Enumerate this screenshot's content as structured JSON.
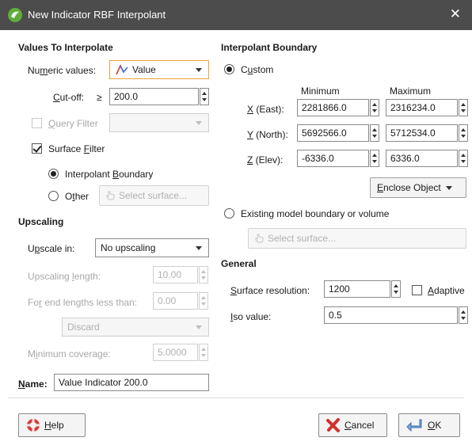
{
  "window": {
    "title": "New Indicator RBF Interpolant",
    "close_glyph": "✕"
  },
  "values_to_interpolate": {
    "header": "Values To Interpolate",
    "numeric_values": {
      "label_pre": "Nu",
      "label_ul": "m",
      "label_post": "eric values:",
      "value": "Value",
      "icon": "indicator-icon"
    },
    "cutoff": {
      "label_ul": "C",
      "label_post": "ut-off:",
      "symbol": "≥",
      "value": "200.0"
    },
    "query_filter": {
      "label_ul": "Q",
      "label_post": "uery Filter",
      "checked": false,
      "enabled": false,
      "value": ""
    },
    "surface_filter": {
      "label_pre": "Surface ",
      "label_ul": "F",
      "label_post": "ilter",
      "checked": true
    },
    "interpolant_boundary_option": {
      "label_pre": "Interpolant ",
      "label_ul": "B",
      "label_post": "oundary",
      "selected": true
    },
    "other_option": {
      "label_pre": "O",
      "label_ul": "t",
      "label_post": "her",
      "selected": false,
      "select_surface_label": "Select surface..."
    }
  },
  "upscaling": {
    "header": "Upscaling",
    "upscale_in": {
      "label_pre": "U",
      "label_ul": "p",
      "label_post": "scale in:",
      "value": "No upscaling"
    },
    "upscaling_length": {
      "label_pre": "Upscaling ",
      "label_ul": "l",
      "label_post": "ength:",
      "value": "10.00"
    },
    "end_lengths": {
      "label_pre": "Fo",
      "label_ul": "r",
      "label_post": " end lengths less than:",
      "value": "0.00"
    },
    "end_action": {
      "value": "Discard"
    },
    "minimum_coverage": {
      "label_pre": "M",
      "label_ul": "i",
      "label_post": "nimum coverage:",
      "value": "5.0000"
    }
  },
  "name": {
    "label_ul": "N",
    "label_post": "ame:",
    "value": "Value Indicator 200.0"
  },
  "interpolant_boundary": {
    "header": "Interpolant Boundary",
    "custom_option": {
      "label_pre": "C",
      "label_ul": "u",
      "label_post": "stom",
      "selected": true
    },
    "col_min": "Minimum",
    "col_max": "Maximum",
    "rows": [
      {
        "label_ul": "X",
        "label_post": " (East):",
        "min": "2281866.0",
        "max": "2316234.0"
      },
      {
        "label_ul": "Y",
        "label_post": " (North):",
        "min": "5692566.0",
        "max": "5712534.0"
      },
      {
        "label_ul": "Z",
        "label_post": " (Elev):",
        "min": "-6336.0",
        "max": "6336.0"
      }
    ],
    "enclose_object": {
      "label_ul": "E",
      "label_post": "nclose Object"
    },
    "existing_option": {
      "label": "Existing model boundary or volume",
      "selected": false
    },
    "select_surface_label": "Select surface..."
  },
  "general": {
    "header": "General",
    "surface_resolution": {
      "label_ul": "S",
      "label_post": "urface resolution:",
      "value": "1200"
    },
    "adaptive": {
      "label_ul": "A",
      "label_post": "daptive",
      "checked": false
    },
    "iso_value": {
      "label_ul": "I",
      "label_post": "so value:",
      "value": "0.5"
    }
  },
  "footer": {
    "help": {
      "label_ul": "H",
      "label_post": "elp",
      "icon": "lifebuoy-icon"
    },
    "cancel": {
      "label_ul": "C",
      "label_post": "ancel",
      "icon": "cross-icon"
    },
    "ok": {
      "label_ul": "O",
      "label_post": "K",
      "icon": "ok-arrow-icon"
    }
  },
  "colors": {
    "titlebar": "#4c4c4c",
    "focus_border": "#e8a23a",
    "icon_green": "#5fae3a"
  }
}
